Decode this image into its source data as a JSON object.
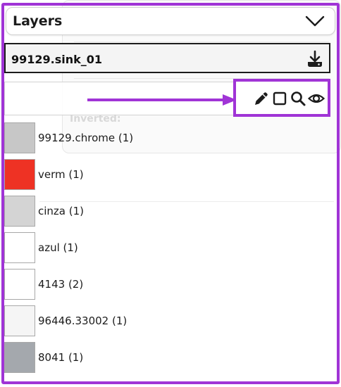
{
  "panel": {
    "title": "Layers",
    "selected_layer": "99129.sink_01"
  },
  "background": {
    "inverted_label": "Inverted:"
  },
  "toolbar": {
    "tools": [
      {
        "name": "pencil-icon",
        "label": "Edit"
      },
      {
        "name": "square-icon",
        "label": "Box"
      },
      {
        "name": "search-icon",
        "label": "Search"
      },
      {
        "name": "eye-icon",
        "label": "Visibility"
      }
    ]
  },
  "colors": {
    "highlight": "#a034d6"
  },
  "layers": [
    {
      "label": "99129.chrome (1)",
      "color": "#c7c7c7"
    },
    {
      "label": "verm (1)",
      "color": "#ee3224"
    },
    {
      "label": "cinza (1)",
      "color": "#d4d4d4"
    },
    {
      "label": "azul (1)",
      "color": "#ffffff"
    },
    {
      "label": "4143 (2)",
      "color": "#ffffff"
    },
    {
      "label": "96446.33002 (1)",
      "color": "#f5f5f5"
    },
    {
      "label": "8041 (1)",
      "color": "#a4a8ad"
    }
  ]
}
